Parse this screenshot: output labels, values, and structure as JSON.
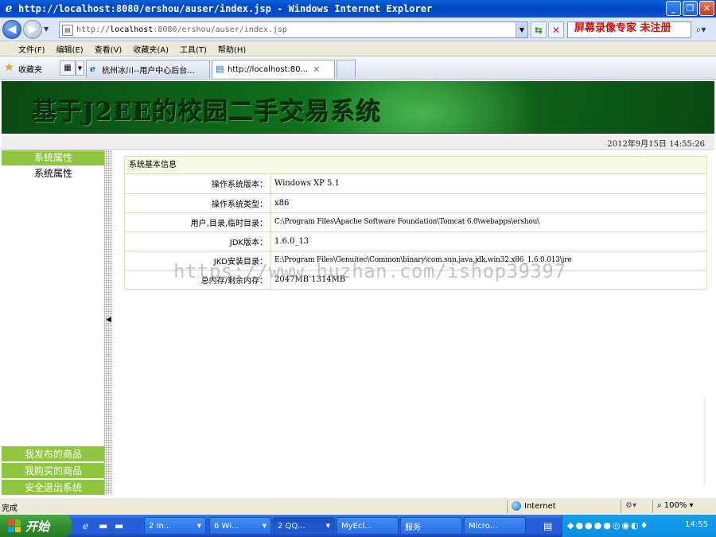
{
  "window": {
    "title": "http://localhost:8080/ershou/auser/index.jsp - Windows Internet Explorer"
  },
  "address": {
    "url_prefix": "http://",
    "url_host": "localhost",
    "url_path": ":8080/ershou/auser/index.jsp"
  },
  "recorder_watermark": "屏幕录像专家 未注册",
  "menu": [
    "文件(F)",
    "编辑(E)",
    "查看(V)",
    "收藏夹(A)",
    "工具(T)",
    "帮助(H)"
  ],
  "favorites": {
    "label": "收藏夹",
    "tabs": [
      {
        "label": "杭州冰川--用户中心后台...",
        "active": false
      },
      {
        "label": "http://localhost:80...",
        "active": true
      }
    ]
  },
  "page": {
    "banner_title": "基于J2EE的校园二手交易系统",
    "datetime": "2012年9月15日  14:55:26",
    "sidebar": {
      "header": "系统属性",
      "item": "系统属性",
      "bottom_links": [
        "我发布的商品",
        "我购买的商品",
        "安全退出系统"
      ]
    },
    "info": {
      "header": "系统基本信息",
      "rows": [
        {
          "label": "操作系统版本：",
          "value": "Windows XP  5.1"
        },
        {
          "label": "操作系统类型：",
          "value": "x86"
        },
        {
          "label": "用户,目录,临时目录：",
          "value": "C:\\Program Files\\Apache Software Foundation\\Tomcat 6.0\\webapps\\ershou\\"
        },
        {
          "label": "JDK版本：",
          "value": "1.6.0_13"
        },
        {
          "label": "JKD安装目录：",
          "value": "E:\\Program Files\\Genuitec\\Common\\binary\\com.sun.java.jdk.win32.x86_1.6.0.013\\jre"
        },
        {
          "label": "总内存/剩余内存：",
          "value": "2047MB  1314MB"
        }
      ]
    },
    "overlay_watermark": "https://www.huzhan.com/ishop39397"
  },
  "status": {
    "text": "完成",
    "zone": "Internet",
    "zoom": "100%"
  },
  "taskbar": {
    "start": "开始",
    "tasks": [
      "2 In...",
      "6 Wi...",
      "2 QQ...",
      "MyEcl...",
      "服务",
      "Micro..."
    ],
    "clock": "14:55"
  }
}
